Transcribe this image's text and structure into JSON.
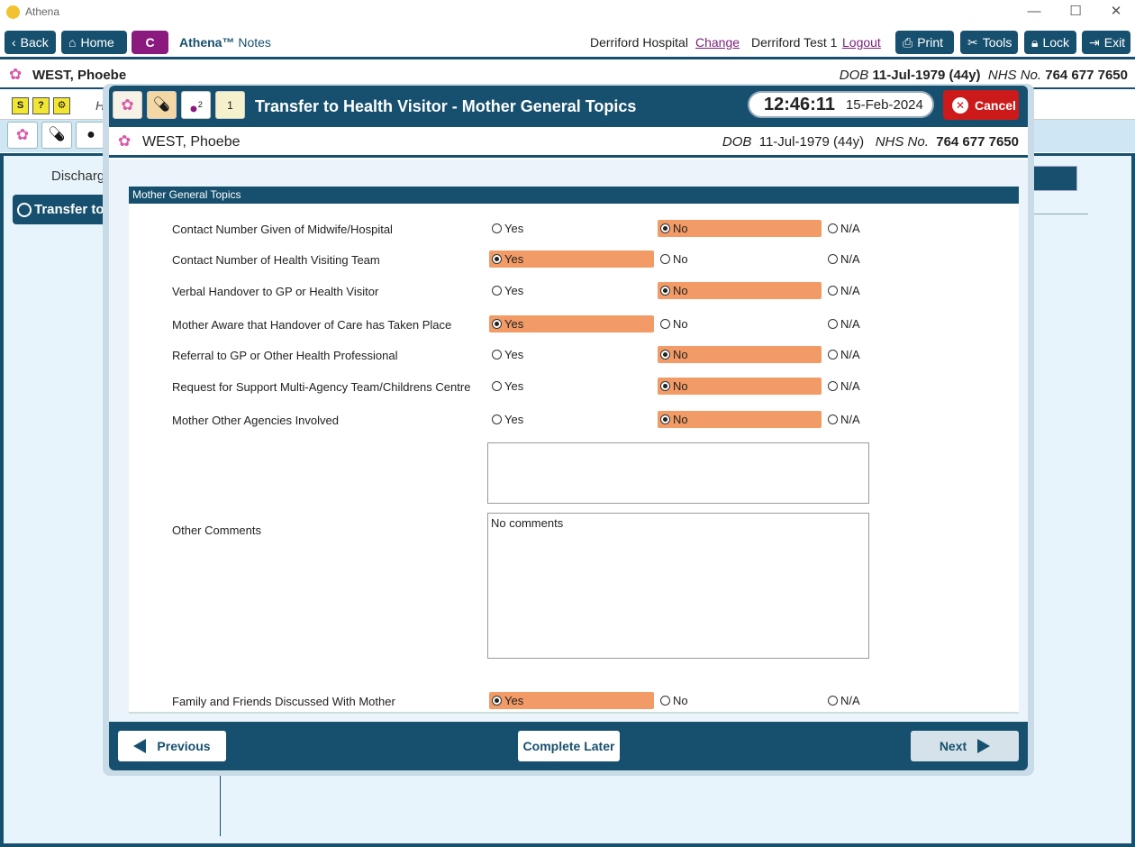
{
  "window": {
    "title": "Athena",
    "minimize": "—",
    "maximize": "☐",
    "close": "✕"
  },
  "nav": {
    "back": "Back",
    "home": "Home",
    "c_button": "C",
    "brand": "Athena™",
    "brand_suffix": "Notes",
    "hospital": "Derriford Hospital",
    "change": "Change",
    "user": "Derriford Test 1",
    "logout": "Logout",
    "print": "Print",
    "tools": "Tools",
    "lock": "Lock",
    "exit": "Exit"
  },
  "patient": {
    "name": "WEST, Phoebe",
    "dob_label": "DOB",
    "dob": "11-Jul-1979 (44y)",
    "nhs_label": "NHS No.",
    "nhs": "764 677 7650"
  },
  "background": {
    "discharge_label": "Discharg",
    "transfer_tab": "Transfer to",
    "h_letter": "H"
  },
  "modal": {
    "title": "Transfer to Health Visitor - Mother General Topics",
    "time": "12:46:11",
    "date": "15-Feb-2024",
    "cancel": "Cancel",
    "icon_badge_2": "2",
    "icon_badge_1": "1"
  },
  "form": {
    "section": "Mother General Topics",
    "option_labels": {
      "yes": "Yes",
      "no": "No",
      "na": "N/A"
    },
    "questions": [
      {
        "label": "Contact Number Given of Midwife/Hospital",
        "selected": "no"
      },
      {
        "label": "Contact Number of Health Visiting Team",
        "selected": "yes"
      },
      {
        "label": "Verbal Handover to GP or Health Visitor",
        "selected": "no"
      },
      {
        "label": "Mother Aware that Handover of Care has Taken Place",
        "selected": "yes"
      },
      {
        "label": "Referral to GP or Other Health Professional",
        "selected": "no"
      },
      {
        "label": "Request for Support Multi-Agency Team/Childrens Centre",
        "selected": "no"
      },
      {
        "label": "Mother Other Agencies Involved",
        "selected": "no"
      }
    ],
    "other_agencies_text": "",
    "other_comments_label": "Other Comments",
    "other_comments_value": "No comments",
    "family_question": {
      "label": "Family and Friends Discussed With Mother",
      "selected": "yes"
    }
  },
  "footer": {
    "previous": "Previous",
    "complete_later": "Complete Later",
    "next": "Next"
  },
  "colors": {
    "primary": "#17506e",
    "selected_option": "#f29b66",
    "cancel": "#cc1a1a",
    "brand_purple": "#8a1a7e"
  }
}
